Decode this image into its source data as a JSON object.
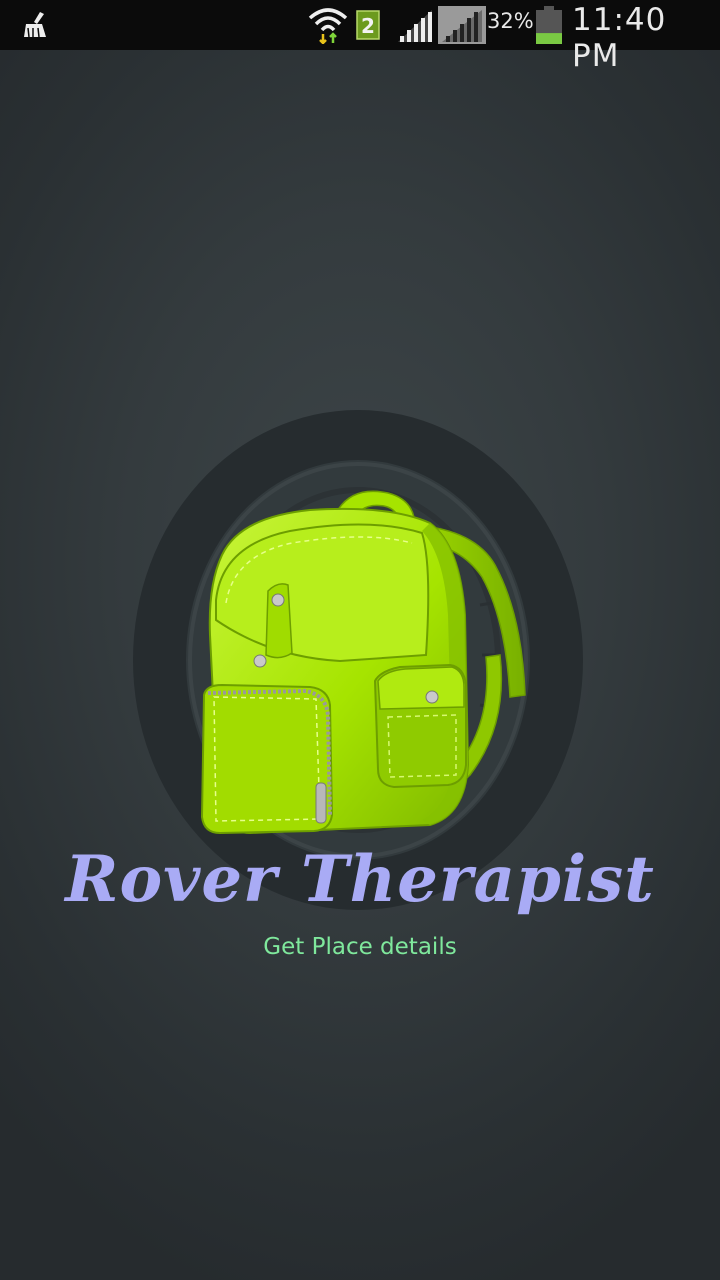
{
  "status_bar": {
    "battery_percent": "32%",
    "time": "11:40 PM",
    "sim_slot": "2",
    "icons": [
      "cleaner-icon",
      "wifi-icon",
      "sim-icon",
      "signal-icon",
      "signal-icon",
      "battery-icon"
    ],
    "battery_level": 0.32
  },
  "app": {
    "title": "Rover Therapist",
    "subtitle": "Get Place details"
  },
  "colors": {
    "title": "#a9abf5",
    "subtitle": "#7fe89c",
    "backpack": "#a6e400",
    "background": "#343b3e"
  }
}
